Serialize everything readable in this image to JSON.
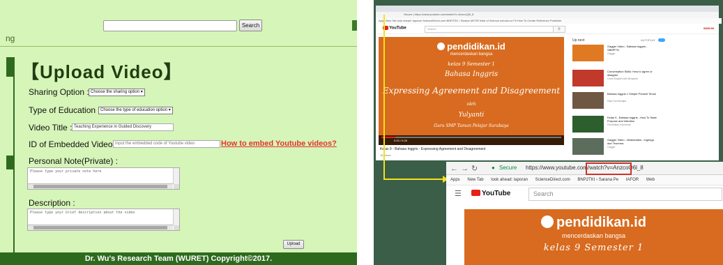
{
  "left_panel": {
    "search_button": "Search",
    "left_fragment": "ng",
    "heading": "【Upload Video】",
    "fields": {
      "sharing_label": "Sharing Option :",
      "sharing_value": "Choose the sharing option ▾",
      "education_label": "Type of Education :",
      "education_value": "Choose the type of education option ▾",
      "title_label": "Video Title :",
      "title_value": "Teaching Experience in Guided Discovery",
      "embed_label": "ID of Embedded Video :",
      "embed_placeholder": "Input the embedded code of Youtube video",
      "embed_link": "How to embed Youtube videos?",
      "note_label": "Personal Note(Private) :",
      "note_placeholder": "Please type your private note here",
      "desc_label": "Description :",
      "desc_placeholder": "Please type your brief description about the video"
    },
    "upload_button": "Upload",
    "footer": "Dr. Wu's Research Team (WURET) Copyright©2017."
  },
  "right_panel": {
    "small_window": {
      "url": "Secure | https://www.youtube.com/watch?v=AnzcoQ6l_8",
      "bookmarks": "Apps  New Tab  look ahead: laporan  ScienceDirect.com  BNP2TKI › Sarana  IAFOR  Web of Science  scholar.co  Fit How To Create  Reference Publisher",
      "logo": "YouTube",
      "search_placeholder": "Search",
      "sign_in": "SIGN IN",
      "video": {
        "brand": "pendidikan.id",
        "tagline": "mencerdaskan bangsa",
        "line1": "kelas 9 Semester 1",
        "line2": "Bahasa Inggris",
        "line3": "Expressing Agreement and Disagreement",
        "line4": "oleh",
        "line5": "Yulyanti",
        "line6": "Guru SMP Taman Pelajar Surabaya",
        "time": "0:03 / 5:28",
        "title": "Kelas 9 - Bahasa Inggris - Expressing Agreement and Disagreement",
        "views": "18 views"
      },
      "up_next": "Up next",
      "autoplay": "AUTOPLAY",
      "suggestions": [
        {
          "title": "Gagger Video - Bahasa Inggris - SBMPTN",
          "meta": "Gagger",
          "color": "#e07a22"
        },
        {
          "title": "Conversation Skills: How to agree or disagree",
          "meta": "Learn English with Benjamin",
          "color": "#c0392b"
        },
        {
          "title": "Bahasa Inggris 1 Simple Present Tense",
          "meta": "Rajin Kursibelajar",
          "color": "#6e5844"
        },
        {
          "title": "Kelas 9 - Bahasa Inggris - How To State Purpose and Intention",
          "meta": "Pendidikan Indonesia",
          "color": "#2c5e2e"
        },
        {
          "title": "Gagger Video - Matematika - Ingringa dan Teorema",
          "meta": "Gagger",
          "color": "#5d6d5d"
        }
      ]
    },
    "zoom_window": {
      "secure": "Secure",
      "url": "https://www.youtube.com/watch?v=AnzcoQ6l_8",
      "bookmarks": [
        "Apps",
        "New Tab",
        "look ahead: laporan",
        "ScienceDirect.com",
        "BNP2TKI › Sarana Pe",
        "IAFOR",
        "Web"
      ],
      "logo": "YouTube",
      "search_placeholder": "Search",
      "brand": "pendidikan.id",
      "tagline": "mencerdaskan bangsa",
      "kelas": "kelas 9 Semester 1"
    }
  },
  "colors": {
    "left_bg": "#d6f5b8",
    "left_dark_green": "#2e6a1e",
    "link_red": "#e6322e",
    "right_bg": "#3b5e49",
    "video_orange": "#d86b1f",
    "arrow_yellow": "#f2e21a",
    "highlight_red": "#d4302a"
  }
}
